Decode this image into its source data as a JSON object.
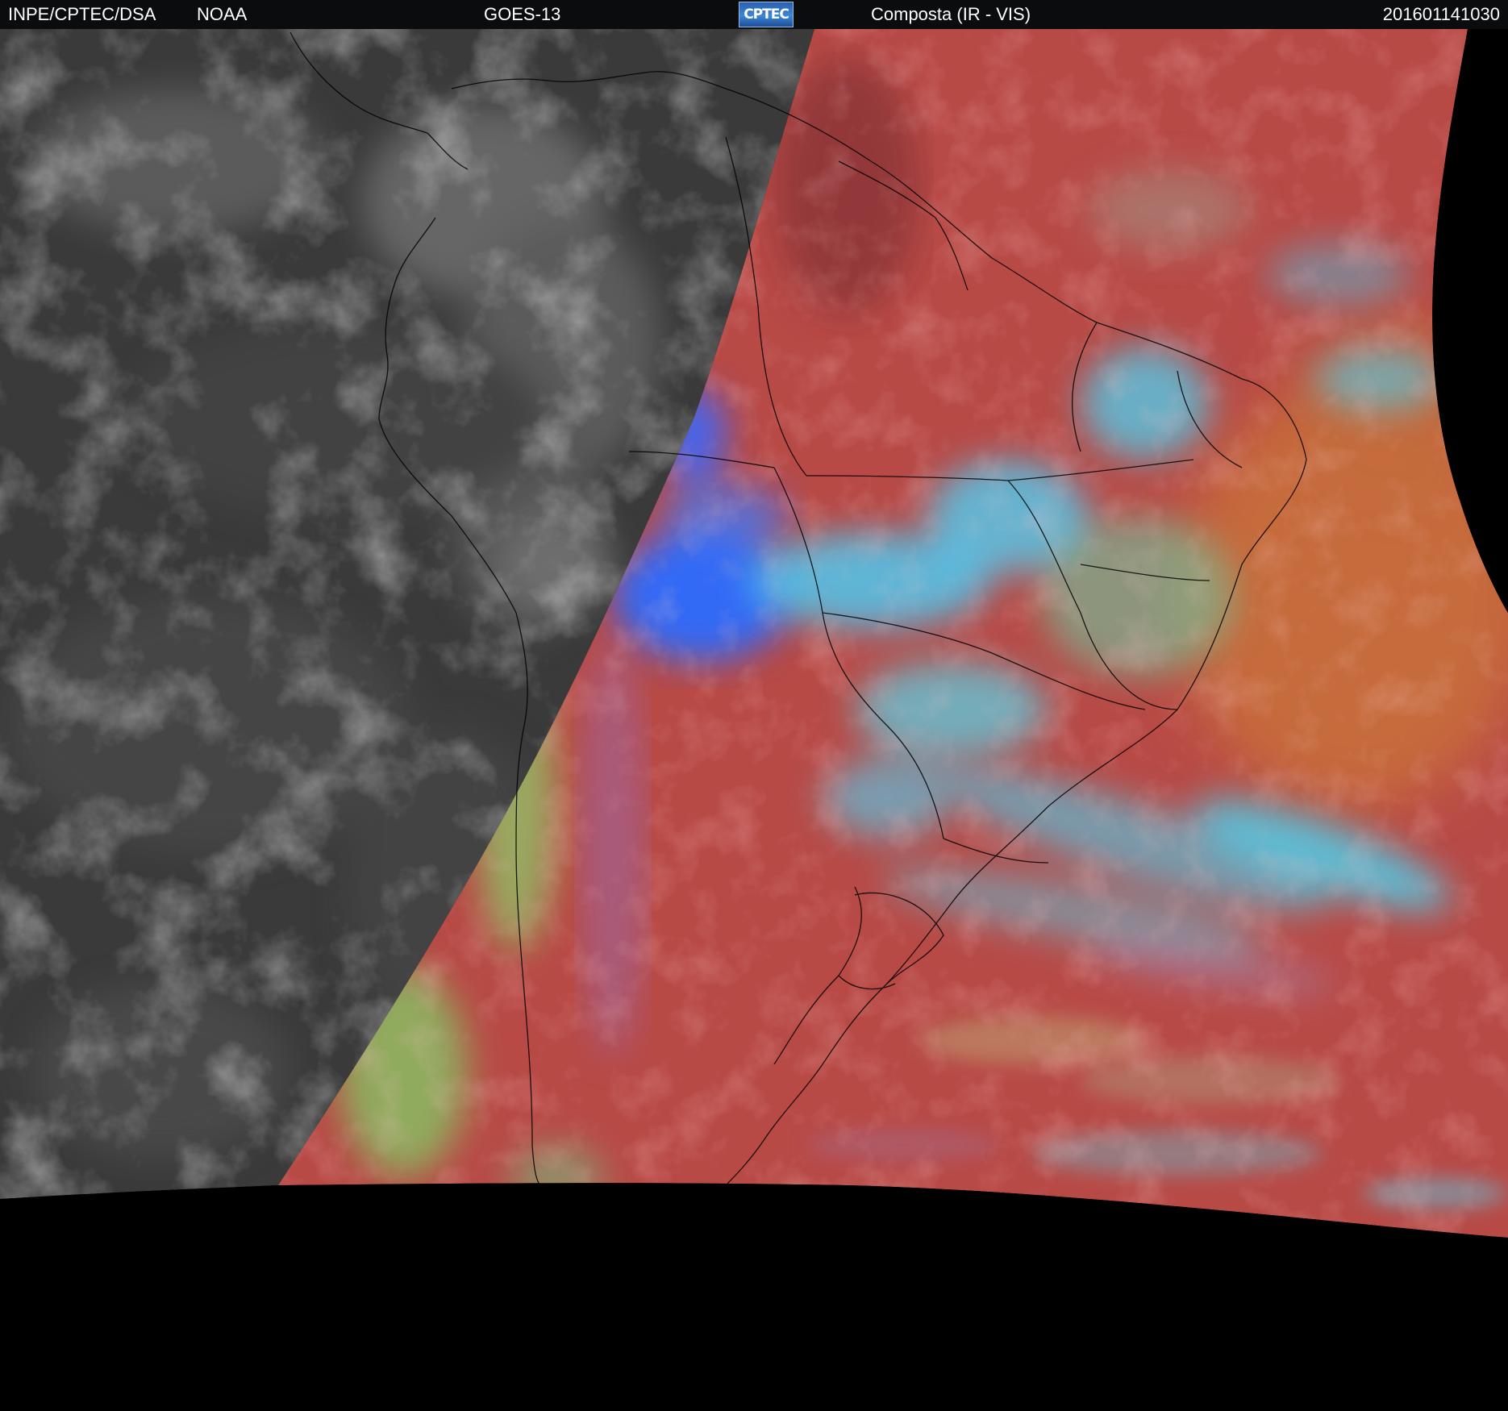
{
  "header": {
    "organization": "INPE/CPTEC/DSA",
    "agency": "NOAA",
    "satellite": "GOES-13",
    "logo_text": "CPTEC",
    "product": "Composta (IR - VIS)",
    "timestamp": "201601141030"
  },
  "colors": {
    "header_background": "#0a0c0e",
    "night_ir_gray": "#3a3a3a",
    "day_land_red": "#b84a46",
    "ocean_orange": "#c46a3c",
    "cloud_cyan": "#4fd0f0",
    "cloud_blue": "#2a6cff",
    "cloud_green": "#8fd06a",
    "off_earth": "#000000",
    "border_lines": "#000000"
  }
}
